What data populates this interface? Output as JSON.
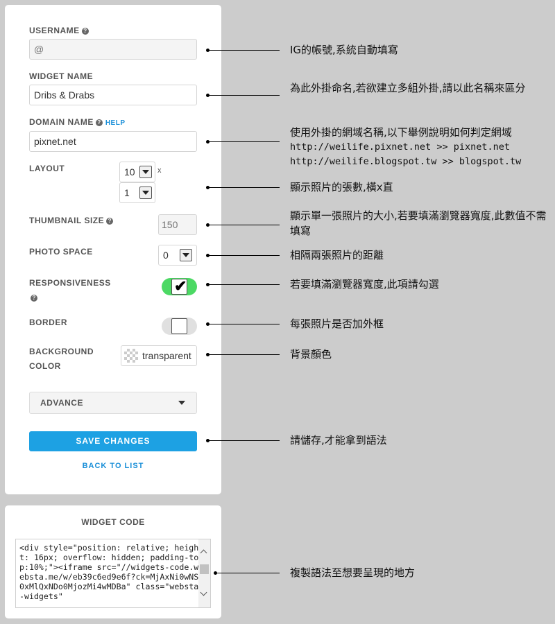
{
  "form": {
    "username": {
      "label": "USERNAME",
      "placeholder": "@",
      "help_icon": "question-icon"
    },
    "widget_name": {
      "label": "WIDGET NAME",
      "value": "Dribs & Drabs"
    },
    "domain_name": {
      "label": "DOMAIN NAME",
      "help_link": "HELP",
      "value": "pixnet.net"
    },
    "layout": {
      "label": "LAYOUT",
      "columns": "10",
      "times": "x",
      "rows": "1"
    },
    "thumbnail_size": {
      "label": "THUMBNAIL SIZE",
      "placeholder": "150"
    },
    "photo_space": {
      "label": "PHOTO SPACE",
      "value": "0"
    },
    "responsiveness": {
      "label": "RESPONSIVENESS",
      "checked": true,
      "check_mark": "✔"
    },
    "border": {
      "label": "BORDER",
      "checked": false
    },
    "background_color": {
      "label_line1": "BACKGROUND",
      "label_line2": "COLOR",
      "value": "transparent"
    },
    "advance": {
      "label": "ADVANCE"
    },
    "save_button": "SAVE CHANGES",
    "back_link": "BACK TO LIST",
    "help_glyph": "?"
  },
  "widget_code": {
    "title": "WIDGET CODE",
    "code": "<div style=\"position: relative; height: 16px; overflow: hidden; padding-top:10%;\"><iframe src=\"//widgets-code.websta.me/w/eb39c6ed9e6f?ck=MjAxNi0wNS0xMlQxNDo0MjozMi4wMDBa\" class=\"websta-widgets\""
  },
  "annotations": {
    "username": "IG的帳號,系統自動填寫",
    "widget_name": "為此外掛命名,若欲建立多組外掛,請以此名稱來區分",
    "domain_name": "使用外掛的網域名稱,以下舉例說明如何判定網域",
    "domain_example_1": "http://weilife.pixnet.net >> pixnet.net",
    "domain_example_2": "http://weilife.blogspot.tw >> blogspot.tw",
    "layout": "顯示照片的張數,橫x直",
    "thumbnail_size": "顯示單一張照片的大小,若要填滿瀏覽器寬度,此數值不需填寫",
    "photo_space": "相隔兩張照片的距離",
    "responsiveness": "若要填滿瀏覽器寬度,此項請勾選",
    "border": "每張照片是否加外框",
    "background_color": "背景顏色",
    "save": "請儲存,才能拿到語法",
    "widget_code": "複製語法至想要呈現的地方"
  },
  "colors": {
    "background": "#cccccc",
    "panel": "#ffffff",
    "accent_blue": "#1da1e3",
    "link_blue": "#1a8fd8",
    "toggle_on": "#4cd964",
    "toggle_off": "#e0e0e0"
  }
}
